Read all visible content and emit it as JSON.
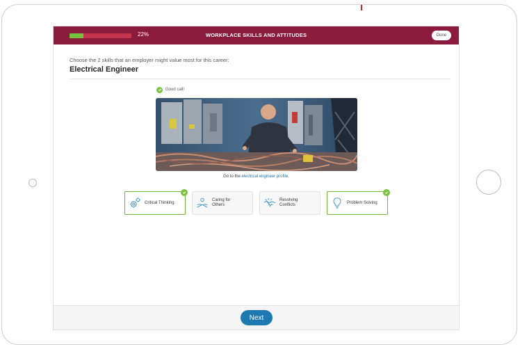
{
  "header": {
    "progress_percent": 22,
    "progress_label": "22%",
    "title": "WORKPLACE SKILLS AND ATTITUDES",
    "done_label": "Done"
  },
  "question": {
    "prompt": "Choose the 2 skills that an employer might value most for this career:",
    "career": "Electrical Engineer"
  },
  "feedback": {
    "text": "Good call!",
    "icon": "check-circle-icon"
  },
  "caption": {
    "prefix": "Go to the ",
    "link": "electrical engineer profile",
    "suffix": "."
  },
  "skills": [
    {
      "label": "Critical Thinking",
      "selected": true,
      "icon": "gears-icon"
    },
    {
      "label": "Caring for Others",
      "selected": false,
      "icon": "caring-hands-icon"
    },
    {
      "label": "Resolving Conflicts",
      "selected": false,
      "icon": "handshake-icon"
    },
    {
      "label": "Problem Solving",
      "selected": true,
      "icon": "lightbulb-icon"
    }
  ],
  "footer": {
    "next_label": "Next"
  },
  "colors": {
    "header_bg": "#8b1b3c",
    "progress_fill": "#78c13f",
    "accent_blue": "#1f79b1",
    "check_green": "#7cc142"
  }
}
